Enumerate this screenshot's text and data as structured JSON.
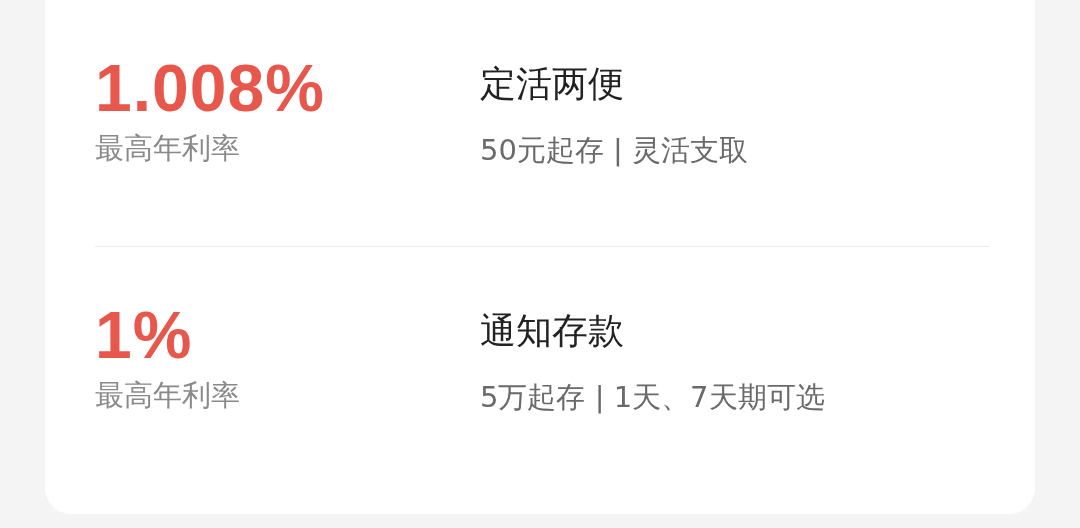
{
  "products": [
    {
      "rate": "1.008%",
      "rate_label": "最高年利率",
      "name": "定活两便",
      "details": "50元起存 | 灵活支取"
    },
    {
      "rate": "1%",
      "rate_label": "最高年利率",
      "name": "通知存款",
      "details": "5万起存 | 1天、7天期可选"
    }
  ]
}
